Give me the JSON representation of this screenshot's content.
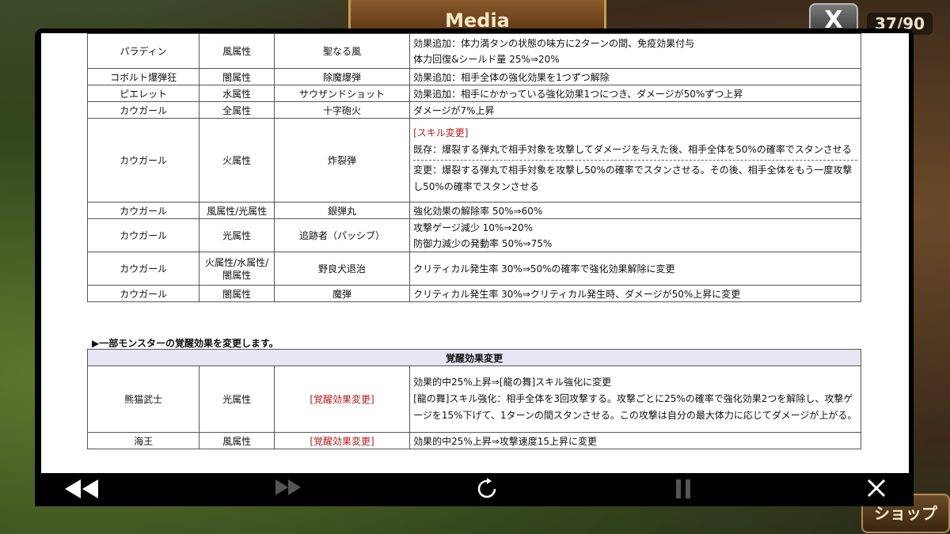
{
  "game": {
    "banner_title": "Media",
    "counter": "37/90",
    "top_close_label": "X",
    "shop_label": "ショップ"
  },
  "table1": {
    "rows": [
      {
        "monster": "パラディン",
        "attr": "風属性",
        "skill": "聖なる風",
        "effects": [
          "効果追加：体力満タンの状態の味方に2ターンの間、免疫効果付与",
          "体力回復&シールド量 25%⇒20%"
        ]
      },
      {
        "monster": "コボルト爆弾狂",
        "attr": "闇属性",
        "skill": "除魔爆弾",
        "effects": [
          "効果追加：相手全体の強化効果を1つずつ解除"
        ]
      },
      {
        "monster": "ピエレット",
        "attr": "水属性",
        "skill": "サウザンドショット",
        "effects": [
          "効果追加：相手にかかっている強化効果1つにつき、ダメージが50%ずつ上昇"
        ]
      },
      {
        "monster": "カウガール",
        "attr": "全属性",
        "skill": "十字砲火",
        "effects": [
          "ダメージが7%上昇"
        ]
      },
      {
        "monster": "カウガール",
        "attr": "火属性",
        "skill": "炸裂弾",
        "tag": "[スキル変更]",
        "before": "既存：爆裂する弾丸で相手対象を攻撃してダメージを与えた後、相手全体を50%の確率でスタンさせる",
        "after": "変更：爆裂する弾丸で相手対象を攻撃し50%の確率でスタンさせる。その後、相手全体をもう一度攻撃し50%の確率でスタンさせる"
      },
      {
        "monster": "カウガール",
        "attr": "風属性/光属性",
        "skill": "銀弾丸",
        "effects": [
          "強化効果の解除率 50%⇒60%"
        ]
      },
      {
        "monster": "カウガール",
        "attr": "光属性",
        "skill": "追跡者（パッシブ）",
        "effects": [
          "攻撃ゲージ減少 10%⇒20%",
          "防御力減少の発動率 50%⇒75%"
        ]
      },
      {
        "monster": "カウガール",
        "attr": "火属性/水属性/闇属性",
        "skill": "野良犬退治",
        "effects": [
          "クリティカル発生率 30%⇒50%の確率で強化効果解除に変更"
        ]
      },
      {
        "monster": "カウガール",
        "attr": "闇属性",
        "skill": "魔弾",
        "effects": [
          "クリティカル発生率 30%⇒クリティカル発生時、ダメージが50%上昇に変更"
        ]
      }
    ]
  },
  "section_title": "▶一部モンスターの覚醒効果を変更します。",
  "table2": {
    "header": "覚醒効果変更",
    "rows": [
      {
        "monster": "熊猫武士",
        "attr": "光属性",
        "skill": "[覚醒効果変更]",
        "effects": [
          "効果的中25%上昇⇒[龍の舞]スキル強化に変更",
          "[龍の舞]スキル強化：相手全体を3回攻撃する。攻撃ごとに25%の確率で強化効果2つを解除し、攻撃ゲージを15%下げて、1ターンの間スタンさせる。この攻撃は自分の最大体力に応じてダメージが上がる。"
        ]
      },
      {
        "monster": "海王",
        "attr": "風属性",
        "skill": "[覚醒効果変更]",
        "effects": [
          "効果的中25%上昇⇒攻撃速度15上昇に変更"
        ]
      }
    ]
  },
  "controls": {
    "rewind_icon": "rewind-icon",
    "forward_icon": "fast-forward-icon",
    "replay_icon": "replay-icon",
    "pause_icon": "pause-icon",
    "close_icon": "close-icon"
  }
}
